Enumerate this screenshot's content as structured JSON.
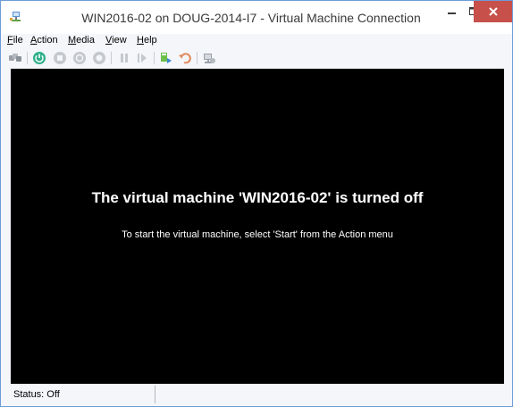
{
  "window": {
    "title": "WIN2016-02 on DOUG-2014-I7 - Virtual Machine Connection",
    "accent_color": "#6d9bd8",
    "close_color": "#c7504b"
  },
  "menu": {
    "items": [
      {
        "accel": "F",
        "rest": "ile"
      },
      {
        "accel": "A",
        "rest": "ction"
      },
      {
        "accel": "M",
        "rest": "edia"
      },
      {
        "accel": "V",
        "rest": "iew"
      },
      {
        "accel": "H",
        "rest": "elp"
      }
    ]
  },
  "toolbar": {
    "icons": [
      "ctrl-alt-del-icon",
      "start-icon",
      "turn-off-icon",
      "shut-down-icon",
      "save-icon",
      "pause-icon",
      "resume-icon",
      "checkpoint-icon",
      "revert-icon",
      "enhanced-session-icon"
    ]
  },
  "screen": {
    "message_title": "The virtual machine 'WIN2016-02' is turned off",
    "message_body": "To start the virtual machine, select 'Start' from the Action menu"
  },
  "status": {
    "text": "Status: Off"
  }
}
